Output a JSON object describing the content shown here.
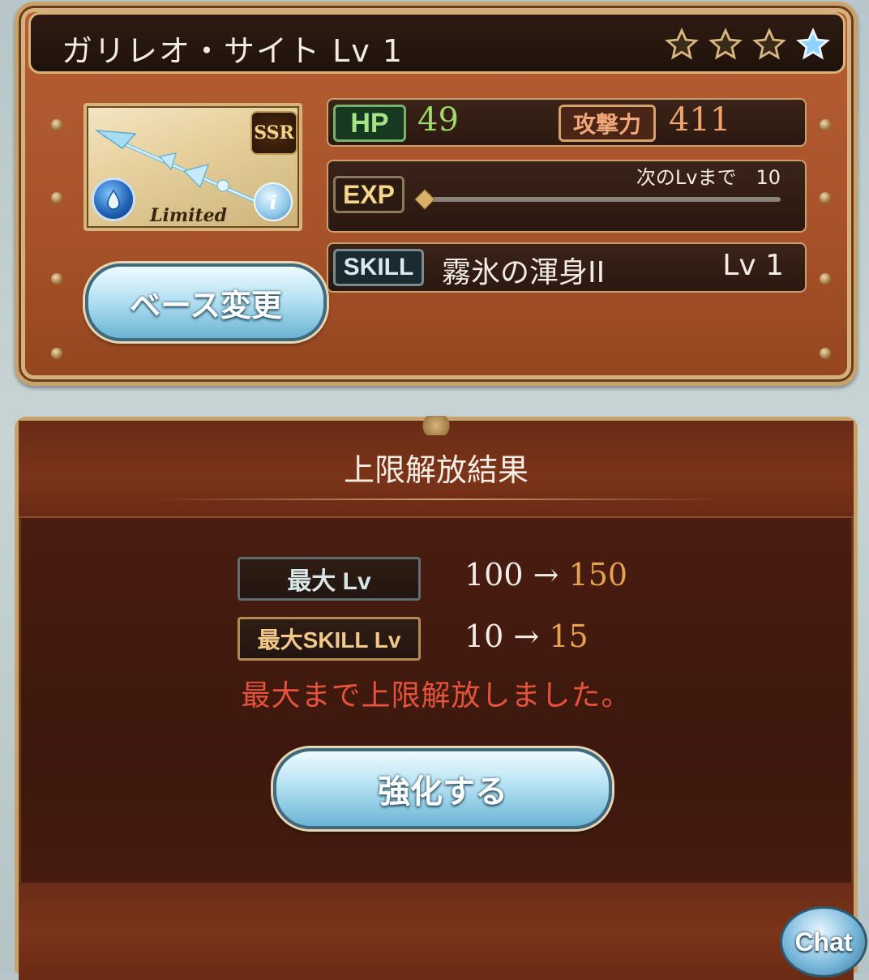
{
  "weapon": {
    "title": "ガリレオ・サイト Lv 1",
    "stars_filled": 3,
    "stars_total": 4,
    "rarity": "SSR",
    "limited_label": "Limited",
    "element": "water",
    "info_glyph": "i"
  },
  "stats": {
    "hp_label": "HP",
    "hp_value": "49",
    "atk_label": "攻撃力",
    "atk_value": "411",
    "exp_label": "EXP",
    "exp_next_text": "次のLvまで　10",
    "exp_progress": 0,
    "skill_label": "SKILL",
    "skill_name": "霧氷の渾身II",
    "skill_lv": "Lv 1"
  },
  "base_button": {
    "label": "ベース変更"
  },
  "result": {
    "title": "上限解放結果",
    "max_lv_label": "最大 Lv",
    "max_lv_old": "100 → ",
    "max_lv_new": "150",
    "max_skill_label": "最大SKILL Lv",
    "max_skill_old": "10 → ",
    "max_skill_new": "15",
    "notice": "最大まで上限解放しました。"
  },
  "enhance_button": {
    "label": "強化する"
  },
  "chat_button": {
    "label": "Chat"
  },
  "colors": {
    "hp_green": "#9fd86a",
    "atk_orange": "#f0a36b",
    "notice_red": "#e5533d",
    "new_value_gold": "#e6a24e"
  }
}
